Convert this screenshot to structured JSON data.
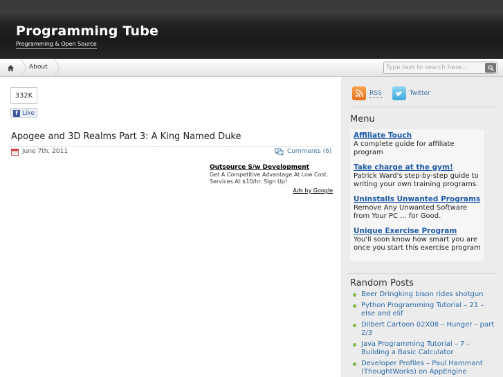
{
  "header": {
    "site_title": "Programming Tube",
    "site_description": "Programming & Open Source"
  },
  "nav": {
    "home_icon": "home-icon",
    "items": [
      {
        "label": "About"
      }
    ],
    "search_placeholder": "Type text to search here...",
    "search_icon": "search-icon"
  },
  "social": {
    "share_count": "332K",
    "like_label": "Like"
  },
  "post": {
    "title": "Apogee and 3D Realms Part 3: A King Named Duke",
    "date": "June 7th, 2011",
    "comments": "Comments (6)"
  },
  "ad": {
    "title": "Outsource S/w Development",
    "text": "Get A Competitive Advantage At Low Cost. Services At $10/hr. Sign Up!",
    "by": "Ads by Google"
  },
  "sidebar": {
    "rss_label": "RSS",
    "twitter_label": "Twitter",
    "menu_title": "Menu",
    "menu_items": [
      {
        "link": "Affiliate Touch ",
        "desc": "A complete guide for affiliate program"
      },
      {
        "link": "Take charge at the gym! ",
        "desc": "Patrick Ward's step-by-step guide to writing your own training programs."
      },
      {
        "link": "Uninstalls Unwanted Programs ",
        "desc": "Remove Any Unwanted Software from Your PC ... for Good."
      },
      {
        "link": "Unique Exercise Program ",
        "desc": "You'll soon know how smart you are once you start this exercise program"
      }
    ],
    "random_title": "Random Posts",
    "random_posts": [
      "Beer Dringking bison rides shotgun",
      "Python Programming Tutorial – 21 – else and elif",
      "Dilbert Cartoon 02X08 – Hunger – part 2/3",
      "Java Programming Tutorial – 7 – Building a Basic Calculator",
      "Developer Profiles – Paul Hammant (ThoughtWorks) on AppEngine"
    ]
  },
  "colors": {
    "header_bg": "#1f1f1f",
    "link_blue": "#1e5aa8",
    "sidebar_bg": "#ececec",
    "bullet_green": "#7cb84b"
  }
}
